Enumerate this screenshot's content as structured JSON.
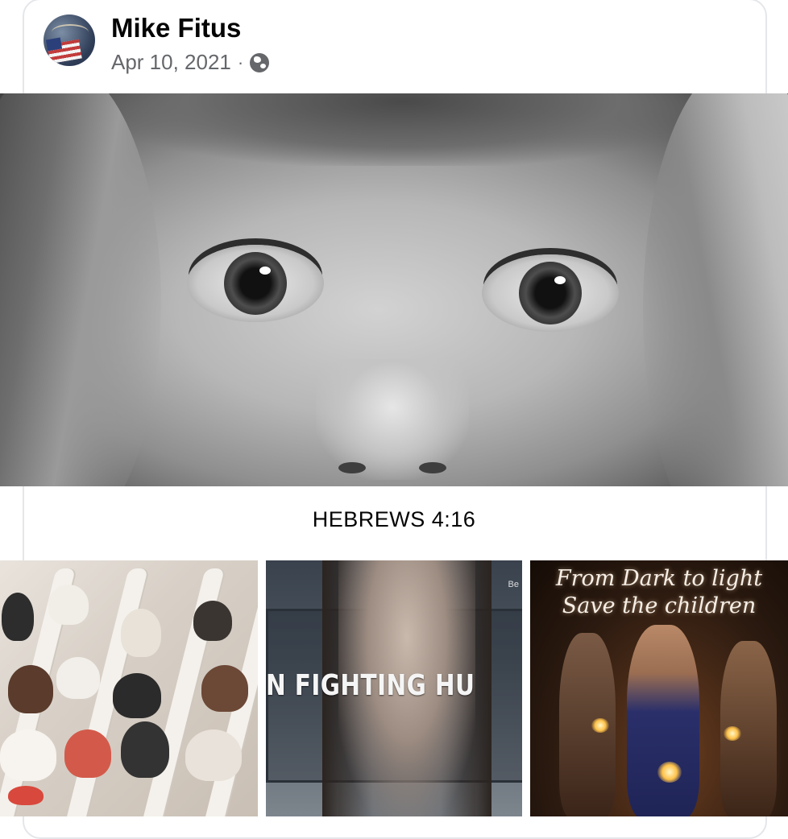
{
  "post": {
    "author": "Mike Fitus",
    "date": "Apr 10, 2021",
    "separator": "·",
    "privacy_icon": "globe-icon",
    "caption": "HEBREWS 4:16"
  },
  "tiles": {
    "bus_banner": "N FIGHTING HUMAN TR",
    "bus_corner": "Be",
    "candle_line1": "From Dark to light",
    "candle_line2": "Save the children"
  },
  "colors": {
    "text_primary": "#050505",
    "text_secondary": "#65676b",
    "card_border": "#e4e6ea"
  }
}
